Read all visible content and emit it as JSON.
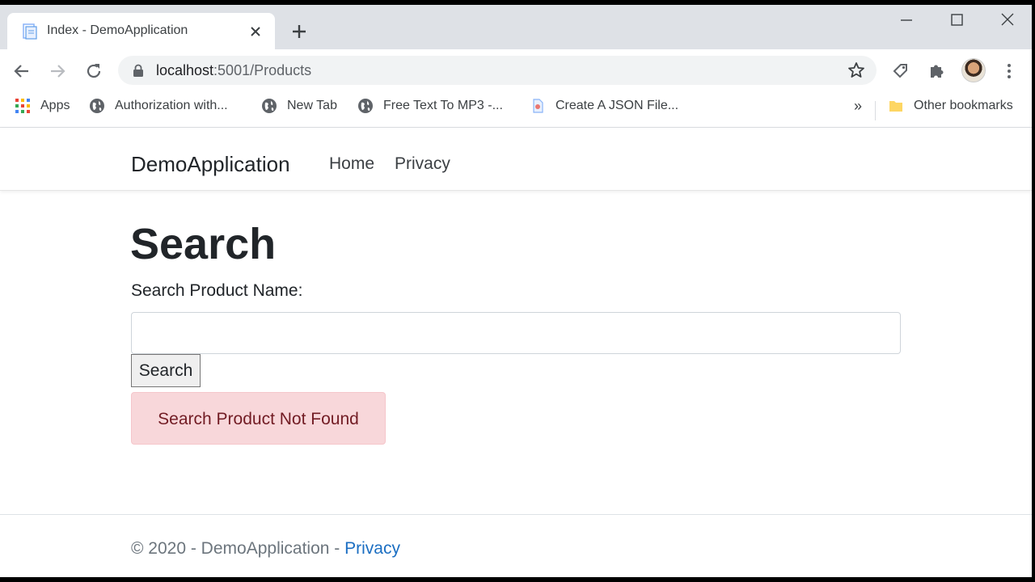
{
  "browser": {
    "tab": {
      "title": "Index - DemoApplication"
    },
    "address_bar": {
      "host": "localhost",
      "port_path": ":5001/Products"
    },
    "bookmarks": [
      {
        "label": "Apps",
        "icon": "apps-grid-icon"
      },
      {
        "label": "Authorization with...",
        "icon": "globe-icon"
      },
      {
        "label": "New Tab",
        "icon": "globe-icon"
      },
      {
        "label": "Free Text To MP3 -...",
        "icon": "globe-icon"
      },
      {
        "label": "Create A JSON File...",
        "icon": "page-icon"
      }
    ],
    "bookmarks_overflow": "»",
    "other_bookmarks": "Other bookmarks"
  },
  "site": {
    "brand": "DemoApplication",
    "nav": [
      {
        "label": "Home"
      },
      {
        "label": "Privacy"
      }
    ]
  },
  "main": {
    "heading": "Search",
    "search_label": "Search Product Name:",
    "search_value": "",
    "search_button": "Search",
    "alert": "Search Product Not Found"
  },
  "footer": {
    "text": "© 2020 - DemoApplication - ",
    "link": "Privacy"
  },
  "colors": {
    "alert_background": "#f8d7da",
    "alert_text": "#721c24",
    "footer_link": "#1b6ec2",
    "tabstrip": "#dee1e6"
  }
}
